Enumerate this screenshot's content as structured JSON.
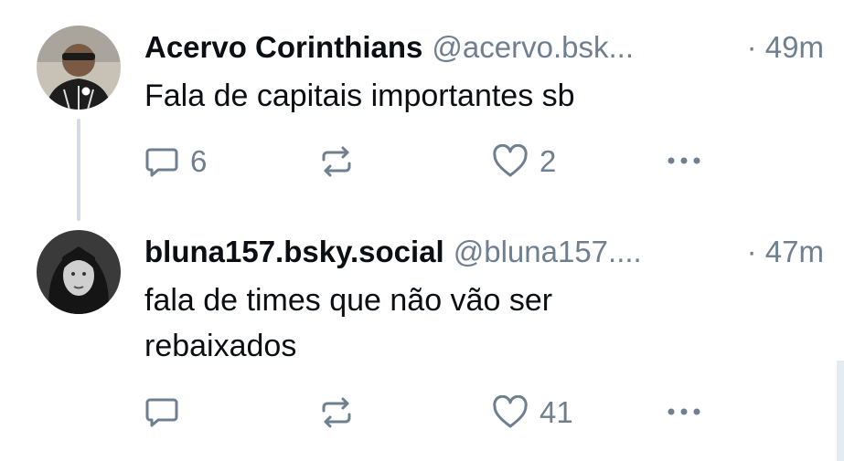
{
  "posts": [
    {
      "author_name": "Acervo Corinthians",
      "handle": "@acervo.bsk...",
      "time": "· 49m",
      "text": "Fala de capitais importantes sb",
      "replies": "6",
      "reposts": "",
      "likes": "2",
      "icons": [
        "reply-icon",
        "repost-icon",
        "like-icon",
        "more-icon"
      ]
    },
    {
      "author_name": "bluna157.bsky.social",
      "handle": "@bluna157....",
      "time": "· 47m",
      "text_lines": [
        "fala de times que não vão ser",
        "rebaixados"
      ],
      "replies": "",
      "reposts": "",
      "likes": "41",
      "icons": [
        "reply-icon",
        "repost-icon",
        "like-icon",
        "more-icon"
      ]
    }
  ],
  "colors": {
    "text": "#0b0f14",
    "muted": "#6f7f8f",
    "thread_line": "#d4dbe2"
  }
}
